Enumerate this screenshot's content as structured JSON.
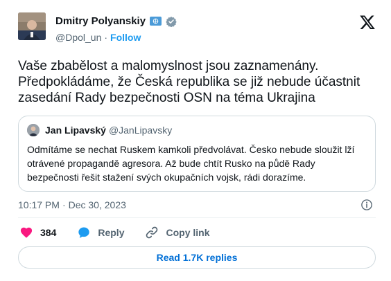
{
  "author": {
    "name": "Dmitry Polyanskiy",
    "handle": "@Dpol_un",
    "follow_label": "Follow",
    "separator": "·"
  },
  "tweet": {
    "text": "Vaše zbabělost a malomyslnost jsou zaznamenány.\nPředpokládáme, že Česká republika se již nebude účastnit\nzasedání Rady bezpečnosti OSN na téma Ukrajina",
    "time": "10:17 PM",
    "date_separator": "·",
    "date": "Dec 30, 2023"
  },
  "quote": {
    "name": "Jan Lipavský",
    "handle": "@JanLipavsky",
    "text": "Odmítáme se nechat Ruskem kamkoli předvolávat. Česko nebude sloužit lží otrávené propagandě agresora. Až bude chtít Rusko na půdě Rady bezpečnosti řešit stažení svých okupačních vojsk, rádi dorazíme."
  },
  "actions": {
    "likes": "384",
    "reply_label": "Reply",
    "copy_label": "Copy link"
  },
  "replies_button": "Read 1.7K replies",
  "icons": [
    "x-logo-icon",
    "un-badge-icon",
    "verified-icon",
    "info-icon",
    "heart-icon",
    "reply-icon",
    "link-icon"
  ],
  "colors": {
    "accent": "#1d9bf0",
    "link": "#006fd6",
    "like": "#f91880",
    "reply": "#1d9bf0",
    "muted": "#536471",
    "border": "#cfd9de"
  }
}
